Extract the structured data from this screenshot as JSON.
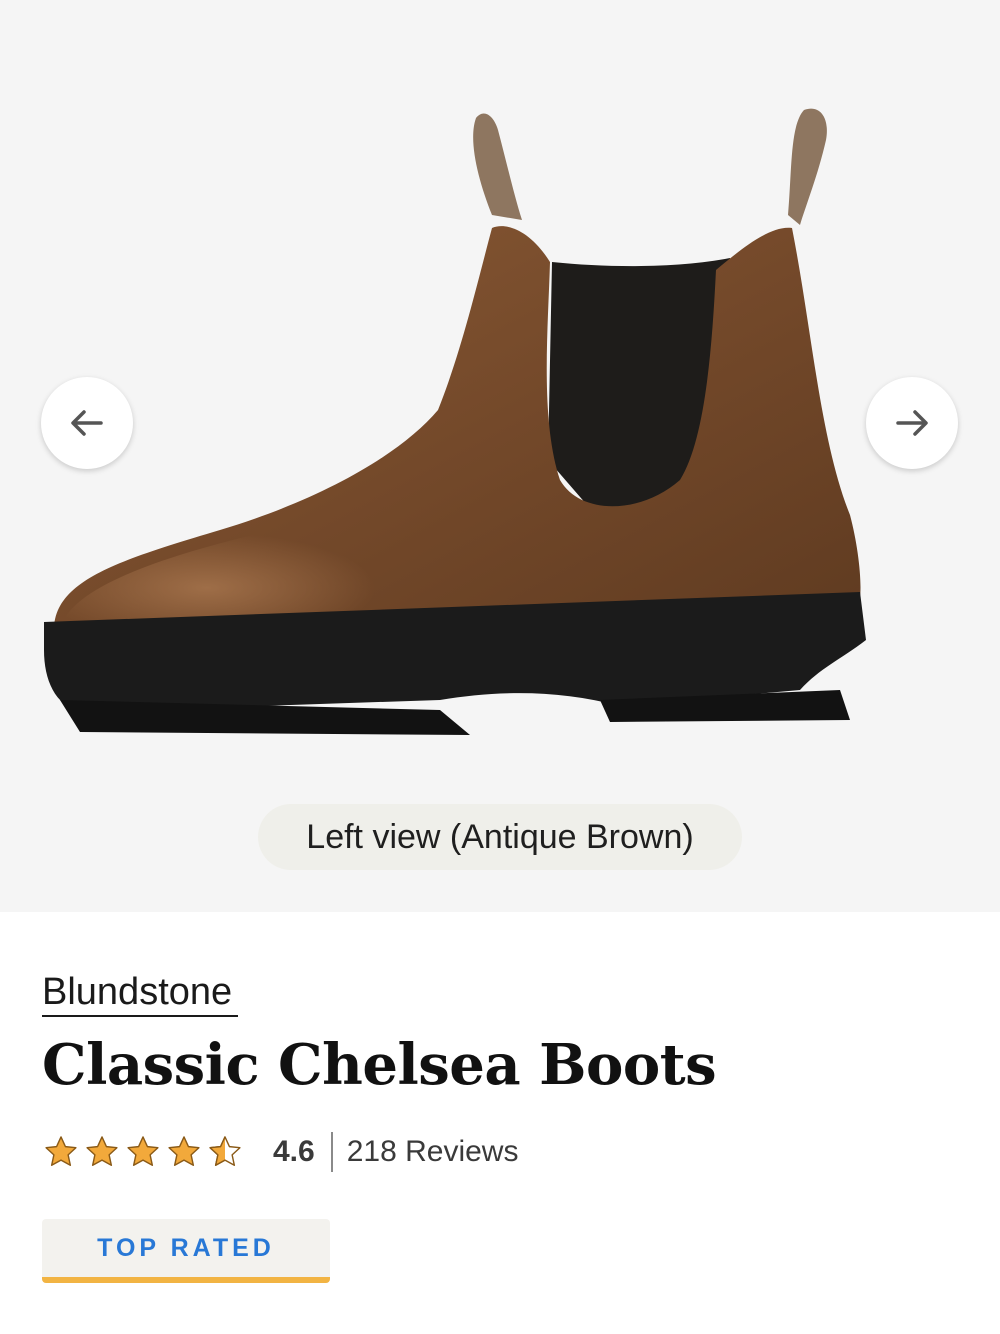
{
  "gallery": {
    "image_alt": "Classic Chelsea Boots",
    "caption": "Left view (Antique Brown)",
    "prev_icon": "arrow-left-icon",
    "next_icon": "arrow-right-icon"
  },
  "product": {
    "brand": "Blundstone",
    "title": "Classic Chelsea Boots",
    "rating": {
      "value": "4.6",
      "score": 4.6,
      "max": 5,
      "reviews": "218 Reviews"
    },
    "badge": "TOP RATED"
  },
  "colors": {
    "star": "#f2a93b",
    "badge_text": "#2878d6",
    "badge_underline": "#f2b443",
    "gallery_bg": "#f5f5f5"
  }
}
